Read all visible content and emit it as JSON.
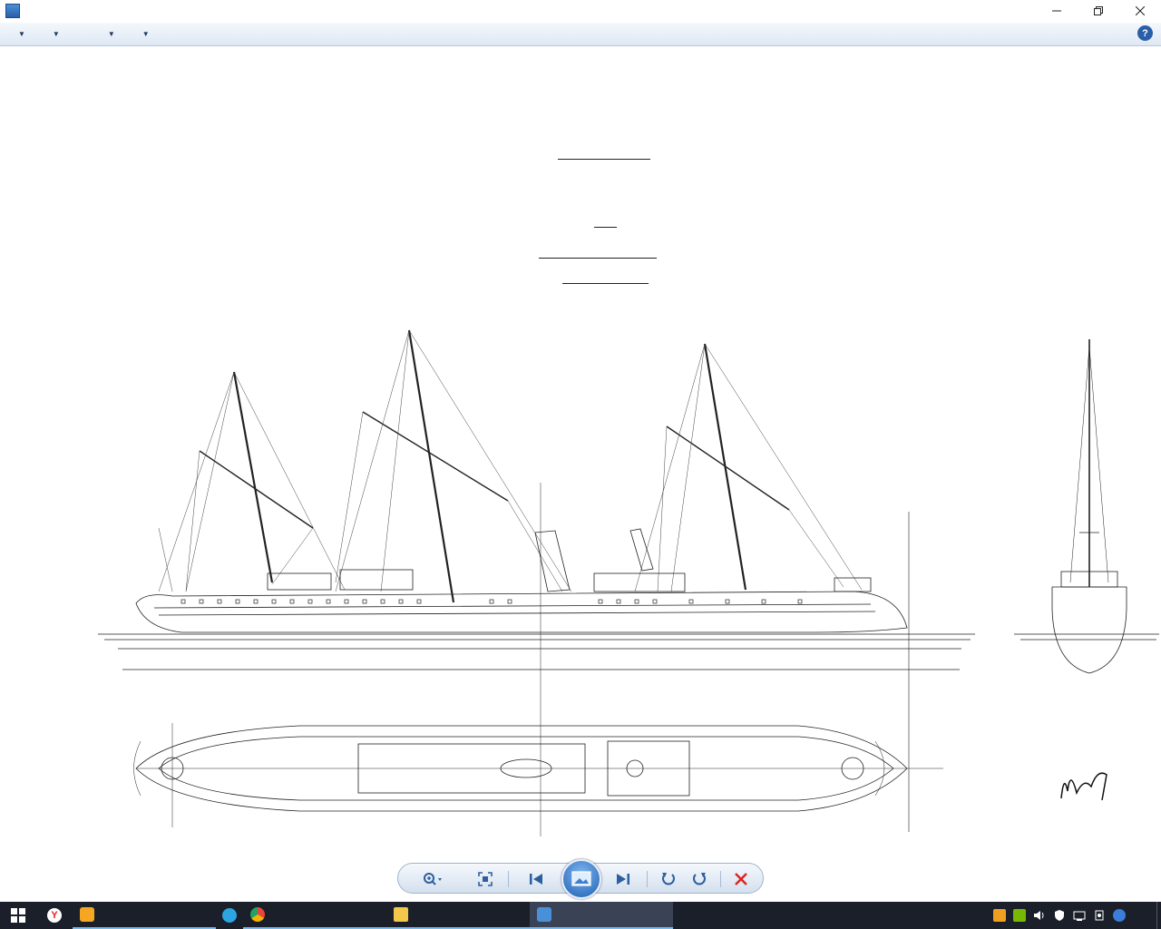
{
  "window": {
    "title": "",
    "minimize_icon": "minimize-icon",
    "restore_icon": "restore-icon",
    "close_icon": "close-icon"
  },
  "menu": {
    "items": [
      {
        "label": "",
        "has_dropdown": true
      },
      {
        "label": "",
        "has_dropdown": true
      },
      {
        "label": "",
        "has_dropdown": false
      },
      {
        "label": "",
        "has_dropdown": true
      },
      {
        "label": "",
        "has_dropdown": true
      }
    ],
    "help_label": "?"
  },
  "drawing": {
    "shipyard": "",
    "header": {
      "marine": "",
      "name": "",
      "class": "",
      "designer": "",
      "plan_title": "",
      "scale": ""
    },
    "signature_block": {
      "place_date": "",
      "engineer": "",
      "company": "",
      "certified": "",
      "marine_engineer": ""
    }
  },
  "toolbar": {
    "zoom_icon": "zoom-icon",
    "fit_icon": "actual-size-icon",
    "prev_icon": "previous-icon",
    "slideshow_icon": "slideshow-icon",
    "next_icon": "next-icon",
    "rotate_ccw_icon": "rotate-counterclockwise-icon",
    "rotate_cw_icon": "rotate-clockwise-icon",
    "delete_icon": "delete-icon"
  },
  "taskbar": {
    "tasks": [
      {
        "label": "",
        "icon": "gamepad-icon",
        "color": "#f5a623",
        "active": false
      },
      {
        "label": "",
        "icon": "telegram-icon",
        "color": "#2ca5e0",
        "active": false
      },
      {
        "label": "",
        "icon": "chrome-icon",
        "color": "#e8453c",
        "active": false
      },
      {
        "label": "",
        "icon": "folder-icon",
        "color": "#f3c74a",
        "active": false
      },
      {
        "label": "",
        "icon": "photo-viewer-icon",
        "color": "#4a90d9",
        "active": true
      }
    ],
    "language": "",
    "time": ""
  },
  "colors": {
    "menubar_text": "#1e395b",
    "taskbar_bg": "#1b1f2a",
    "accent": "#76b9ed"
  }
}
